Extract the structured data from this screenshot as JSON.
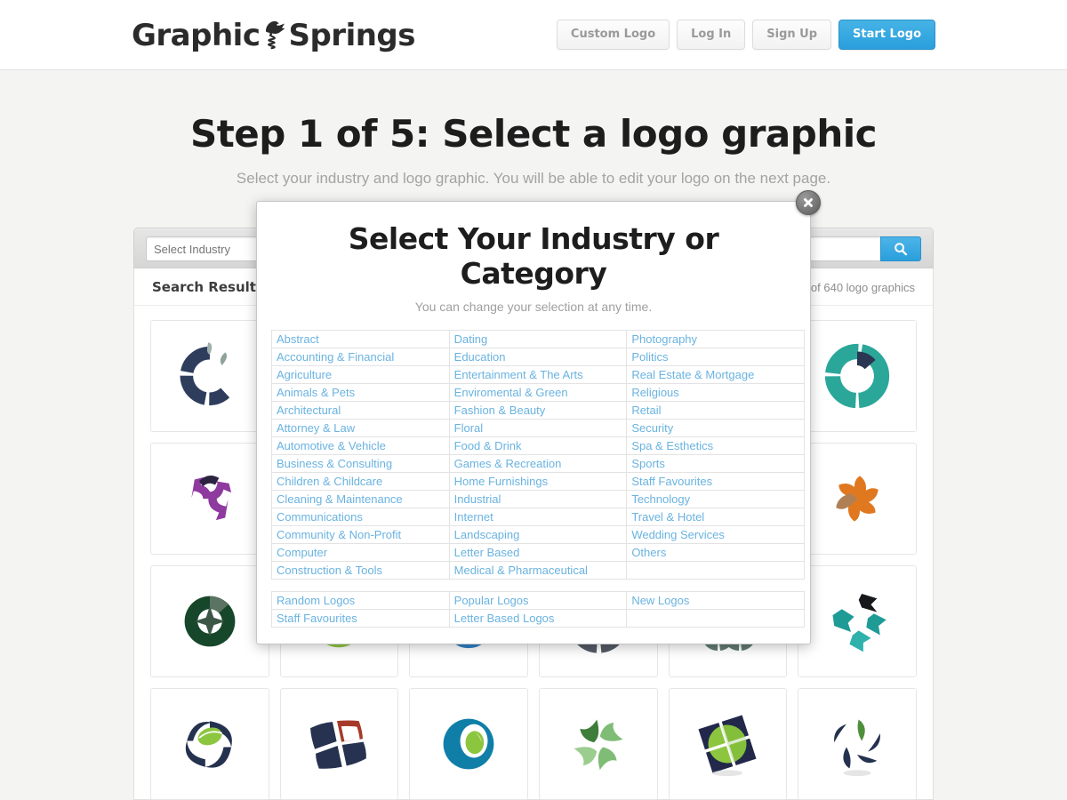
{
  "header": {
    "brand_left": "Graphic",
    "brand_right": "Springs",
    "brand_icon": "kangaroo-on-spring-icon",
    "nav": [
      {
        "label": "Custom Logo",
        "style": "ghost",
        "name": "custom-logo-button"
      },
      {
        "label": "Log In",
        "style": "ghost",
        "name": "log-in-button"
      },
      {
        "label": "Sign Up",
        "style": "ghost",
        "name": "sign-up-button"
      },
      {
        "label": "Start Logo",
        "style": "primary",
        "name": "start-logo-button"
      }
    ],
    "primary_color": "#2a9fdc"
  },
  "page": {
    "title": "Step 1 of 5: Select a logo graphic",
    "subtitle": "Select your industry and logo graphic. You will be able to edit your logo on the next page."
  },
  "search": {
    "industry_placeholder": "Select Industry",
    "industry_value": "",
    "keyword_placeholder": "",
    "keyword_value": "",
    "search_icon": "magnifier-icon"
  },
  "results": {
    "title": "Search Results",
    "count_text": "of 640 logo graphics"
  },
  "modal": {
    "title": "Select Your Industry or Category",
    "subtitle": "You can change your selection at any time.",
    "close_icon": "close-x-icon",
    "link_color": "#6ab3e0",
    "categories": [
      [
        "Abstract",
        "Dating",
        "Photography"
      ],
      [
        "Accounting & Financial",
        "Education",
        "Politics"
      ],
      [
        "Agriculture",
        "Entertainment & The Arts",
        "Real Estate & Mortgage"
      ],
      [
        "Animals & Pets",
        "Enviromental & Green",
        "Religious"
      ],
      [
        "Architectural",
        "Fashion & Beauty",
        "Retail"
      ],
      [
        "Attorney & Law",
        "Floral",
        "Security"
      ],
      [
        "Automotive & Vehicle",
        "Food & Drink",
        "Spa & Esthetics"
      ],
      [
        "Business & Consulting",
        "Games & Recreation",
        "Sports"
      ],
      [
        "Children & Childcare",
        "Home Furnishings",
        "Staff Favourites"
      ],
      [
        "Cleaning & Maintenance",
        "Industrial",
        "Technology"
      ],
      [
        "Communications",
        "Internet",
        "Travel & Hotel"
      ],
      [
        "Community & Non-Profit",
        "Landscaping",
        "Wedding Services"
      ],
      [
        "Computer",
        "Letter Based",
        "Others"
      ],
      [
        "Construction & Tools",
        "Medical & Pharmaceutical",
        ""
      ]
    ],
    "quick_links": [
      [
        "Random Logos",
        "Popular Logos",
        "New Logos"
      ],
      [
        "Staff Favourites",
        "Letter Based Logos",
        ""
      ]
    ]
  },
  "logo_grid": {
    "tiles": [
      {
        "name": "logo-thumb-navy-swirl-ring",
        "icon": "navy-broken-ring"
      },
      {
        "name": "logo-thumb-hidden-1",
        "icon": "hidden"
      },
      {
        "name": "logo-thumb-hidden-2",
        "icon": "hidden"
      },
      {
        "name": "logo-thumb-hidden-3",
        "icon": "hidden"
      },
      {
        "name": "logo-thumb-hidden-4",
        "icon": "hidden"
      },
      {
        "name": "logo-thumb-teal-donut",
        "icon": "teal-donut-ring"
      },
      {
        "name": "logo-thumb-purple-pinwheel",
        "icon": "purple-arrow-pinwheel"
      },
      {
        "name": "logo-thumb-hidden-5",
        "icon": "hidden"
      },
      {
        "name": "logo-thumb-hidden-6",
        "icon": "hidden"
      },
      {
        "name": "logo-thumb-hidden-7",
        "icon": "hidden"
      },
      {
        "name": "logo-thumb-hidden-8",
        "icon": "hidden"
      },
      {
        "name": "logo-thumb-orange-pinwheel",
        "icon": "orange-petal-pinwheel"
      },
      {
        "name": "logo-thumb-green-star-ring",
        "icon": "green-star-circle"
      },
      {
        "name": "logo-thumb-blue-green-globe",
        "icon": "blue-green-swoosh-globe"
      },
      {
        "name": "logo-thumb-leaf-globe",
        "icon": "green-leaf-blue-globe"
      },
      {
        "name": "logo-thumb-gray-sphere-ring",
        "icon": "gray-ring-sphere"
      },
      {
        "name": "logo-thumb-double-ring",
        "icon": "interlocking-dark-rings"
      },
      {
        "name": "logo-thumb-teal-arrows",
        "icon": "teal-black-arrow-cluster"
      },
      {
        "name": "logo-thumb-navy-green-swirl",
        "icon": "navy-swirl-green-leaf"
      },
      {
        "name": "logo-thumb-navy-window",
        "icon": "navy-quad-window-red"
      },
      {
        "name": "logo-thumb-blue-eye",
        "icon": "blue-circle-green-eye"
      },
      {
        "name": "logo-thumb-green-leaf-pinwheel",
        "icon": "green-leaf-pinwheel"
      },
      {
        "name": "logo-thumb-green-navy-diamond",
        "icon": "green-navy-quad-diamond"
      },
      {
        "name": "logo-thumb-navy-green-fan",
        "icon": "navy-green-curved-fan"
      }
    ]
  }
}
